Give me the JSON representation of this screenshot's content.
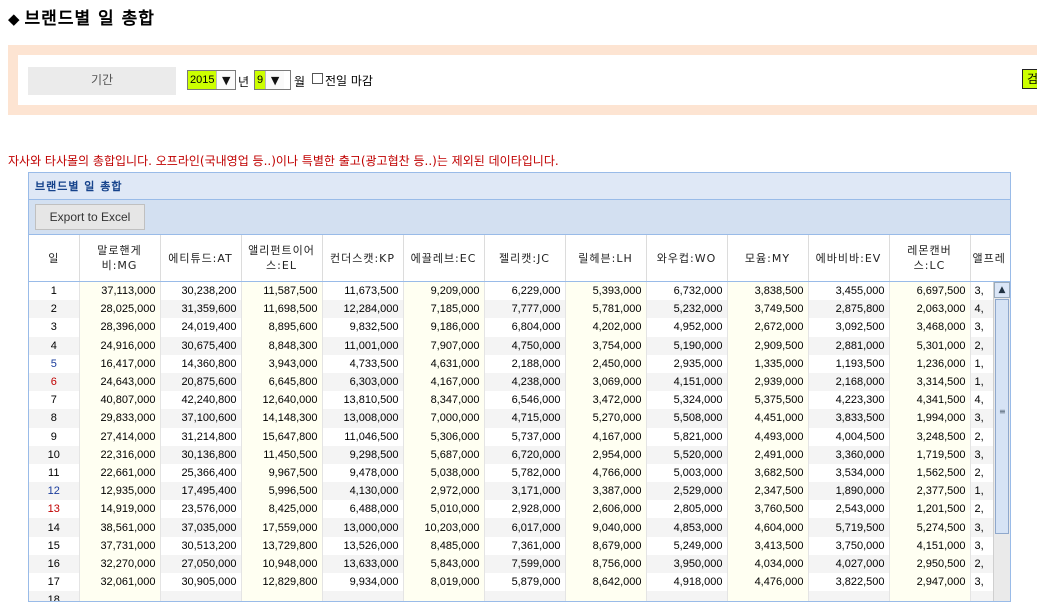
{
  "page": {
    "title_icon": "◆",
    "title": "브랜드별 일 총합"
  },
  "filter": {
    "period_label": "기간",
    "year": "2015",
    "year_unit": "년",
    "month": "9",
    "month_unit": "월",
    "prev_day_close_label": "전일 마감",
    "search_label": "검색"
  },
  "notice": "자사와 타사몰의 총합입니다. 오프라인(국내영업 등..)이나 특별한 출고(광고협찬 등..)는 제외된 데이타입니다.",
  "grid": {
    "title": "브랜드별 일 총합",
    "export_label": "Export to Excel",
    "columns": [
      "일",
      "말로핸게비:MG",
      "에티튜드:AT",
      "앨리펀트이어스:EL",
      "컨더스캣:KP",
      "에끌레브:EC",
      "젤리캣:JC",
      "릴헤븐:LH",
      "와우컵:WO",
      "모윰:MY",
      "에바비바:EV",
      "레몬캔버스:LC",
      "앨프레"
    ],
    "rows": [
      [
        "1",
        "37,113,000",
        "30,238,200",
        "11,587,500",
        "11,673,500",
        "9,209,000",
        "6,229,000",
        "5,393,000",
        "6,732,000",
        "3,838,500",
        "3,455,000",
        "6,697,500",
        "3,"
      ],
      [
        "2",
        "28,025,000",
        "31,359,600",
        "11,698,500",
        "12,284,000",
        "7,185,000",
        "7,777,000",
        "5,781,000",
        "5,232,000",
        "3,749,500",
        "2,875,800",
        "2,063,000",
        "4,"
      ],
      [
        "3",
        "28,396,000",
        "24,019,400",
        "8,895,600",
        "9,832,500",
        "9,186,000",
        "6,804,000",
        "4,202,000",
        "4,952,000",
        "2,672,000",
        "3,092,500",
        "3,468,000",
        "3,"
      ],
      [
        "4",
        "24,916,000",
        "30,675,400",
        "8,848,300",
        "11,001,000",
        "7,907,000",
        "4,750,000",
        "3,754,000",
        "5,190,000",
        "2,909,500",
        "2,881,000",
        "5,301,000",
        "2,"
      ],
      [
        "5",
        "16,417,000",
        "14,360,800",
        "3,943,000",
        "4,733,500",
        "4,631,000",
        "2,188,000",
        "2,450,000",
        "2,935,000",
        "1,335,000",
        "1,193,500",
        "1,236,000",
        "1,"
      ],
      [
        "6",
        "24,643,000",
        "20,875,600",
        "6,645,800",
        "6,303,000",
        "4,167,000",
        "4,238,000",
        "3,069,000",
        "4,151,000",
        "2,939,000",
        "2,168,000",
        "3,314,500",
        "1,"
      ],
      [
        "7",
        "40,807,000",
        "42,240,800",
        "12,640,000",
        "13,810,500",
        "8,347,000",
        "6,546,000",
        "3,472,000",
        "5,324,000",
        "5,375,500",
        "4,223,300",
        "4,341,500",
        "4,"
      ],
      [
        "8",
        "29,833,000",
        "37,100,600",
        "14,148,300",
        "13,008,000",
        "7,000,000",
        "4,715,000",
        "5,270,000",
        "5,508,000",
        "4,451,000",
        "3,833,500",
        "1,994,000",
        "3,"
      ],
      [
        "9",
        "27,414,000",
        "31,214,800",
        "15,647,800",
        "11,046,500",
        "5,306,000",
        "5,737,000",
        "4,167,000",
        "5,821,000",
        "4,493,000",
        "4,004,500",
        "3,248,500",
        "2,"
      ],
      [
        "10",
        "22,316,000",
        "30,136,800",
        "11,450,500",
        "9,298,500",
        "5,687,000",
        "6,720,000",
        "2,954,000",
        "5,520,000",
        "2,491,000",
        "3,360,000",
        "1,719,500",
        "3,"
      ],
      [
        "11",
        "22,661,000",
        "25,366,400",
        "9,967,500",
        "9,478,000",
        "5,038,000",
        "5,782,000",
        "4,766,000",
        "5,003,000",
        "3,682,500",
        "3,534,000",
        "1,562,500",
        "2,"
      ],
      [
        "12",
        "12,935,000",
        "17,495,400",
        "5,996,500",
        "4,130,000",
        "2,972,000",
        "3,171,000",
        "3,387,000",
        "2,529,000",
        "2,347,500",
        "1,890,000",
        "2,377,500",
        "1,"
      ],
      [
        "13",
        "14,919,000",
        "23,576,000",
        "8,425,000",
        "6,488,000",
        "5,010,000",
        "2,928,000",
        "2,606,000",
        "2,805,000",
        "3,760,500",
        "2,543,000",
        "1,201,500",
        "2,"
      ],
      [
        "14",
        "38,561,000",
        "37,035,000",
        "17,559,000",
        "13,000,000",
        "10,203,000",
        "6,017,000",
        "9,040,000",
        "4,853,000",
        "4,604,000",
        "5,719,500",
        "5,274,500",
        "3,"
      ],
      [
        "15",
        "37,731,000",
        "30,513,200",
        "13,729,800",
        "13,526,000",
        "8,485,000",
        "7,361,000",
        "8,679,000",
        "5,249,000",
        "3,413,500",
        "3,750,000",
        "4,151,000",
        "3,"
      ],
      [
        "16",
        "32,270,000",
        "27,050,000",
        "10,948,000",
        "13,633,000",
        "5,843,000",
        "7,599,000",
        "8,756,000",
        "3,950,000",
        "4,034,000",
        "4,027,000",
        "2,950,500",
        "2,"
      ],
      [
        "17",
        "32,061,000",
        "30,905,000",
        "12,829,800",
        "9,934,000",
        "8,019,000",
        "5,879,000",
        "8,642,000",
        "4,918,000",
        "4,476,000",
        "3,822,500",
        "2,947,000",
        "3,"
      ],
      [
        "18",
        "",
        "",
        "",
        "",
        "",
        "",
        "",
        "",
        "",
        "",
        "",
        ""
      ]
    ],
    "saturday_days": [
      "5",
      "12"
    ],
    "sunday_days": [
      "6",
      "13"
    ]
  },
  "colors": {
    "filter_band": "#fde4d2",
    "select_highlight": "#ccff00",
    "notice_text": "#c00000",
    "grid_header": "#dfe8f6",
    "grid_border": "#99bbe8"
  }
}
